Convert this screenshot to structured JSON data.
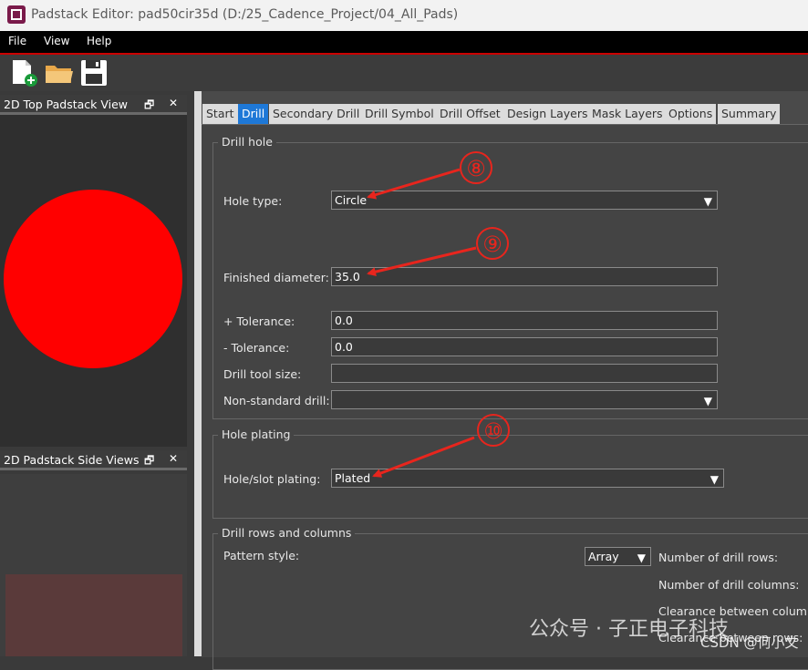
{
  "window": {
    "title": "Padstack Editor: pad50cir35d  (D:/25_Cadence_Project/04_All_Pads)"
  },
  "menu": {
    "items": [
      "File",
      "View",
      "Help"
    ]
  },
  "toolbar": {
    "buttons": [
      "new-icon",
      "open-folder-icon",
      "save-icon"
    ]
  },
  "panels": {
    "top_view": {
      "title": "2D Top Padstack View",
      "restore": "🗗",
      "close": "✕"
    },
    "side_view": {
      "title": "2D Padstack Side Views",
      "restore": "🗗",
      "close": "✕"
    }
  },
  "tabs": [
    "Start",
    "Drill",
    "Secondary Drill",
    "Drill Symbol",
    "Drill Offset",
    "Design Layers",
    "Mask Layers",
    "Options",
    "Summary"
  ],
  "active_tab": "Drill",
  "drill_hole": {
    "group_title": "Drill hole",
    "hole_type_label": "Hole type:",
    "hole_type_value": "Circle",
    "finished_diameter_label": "Finished diameter:",
    "finished_diameter_value": "35.0",
    "plus_tol_label": "+ Tolerance:",
    "plus_tol_value": "0.0",
    "minus_tol_label": "- Tolerance:",
    "minus_tol_value": "0.0",
    "tool_size_label": "Drill tool size:",
    "tool_size_value": "",
    "nonstd_label": "Non-standard drill:",
    "nonstd_value": ""
  },
  "hole_plating": {
    "group_title": "Hole plating",
    "label": "Hole/slot plating:",
    "value": "Plated"
  },
  "drill_rows": {
    "group_title": "Drill rows and columns",
    "pattern_label": "Pattern style:",
    "pattern_value": "Array",
    "rows_label": "Number of drill rows:",
    "cols_label": "Number of drill columns:",
    "clr_cols_label": "Clearance between columns:",
    "clr_rows_label": "Clearance between rows:"
  },
  "annotations": [
    "⑧",
    "⑨",
    "⑩"
  ],
  "annotation_color": "#e8251d",
  "accent_color": "#1e78d7",
  "watermark": {
    "line1": "公众号 · 子正电子科技",
    "line2": "CSDN @何小文"
  }
}
